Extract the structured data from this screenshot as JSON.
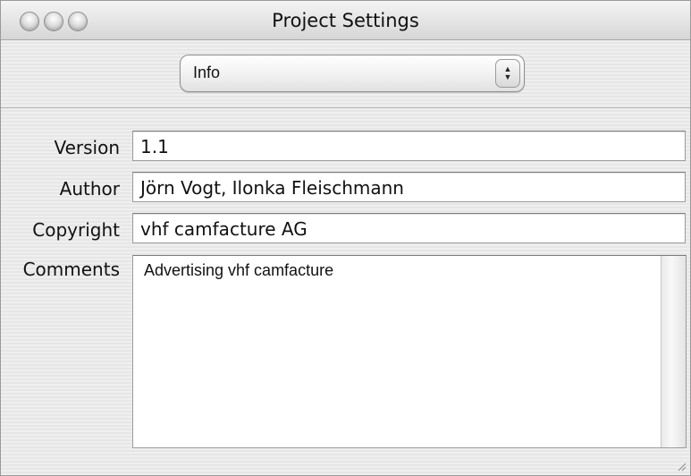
{
  "window": {
    "title": "Project Settings"
  },
  "popup": {
    "selected": "Info",
    "arrows_up": "▲",
    "arrows_down": "▼"
  },
  "form": {
    "version_label": "Version",
    "version_value": "1.1",
    "author_label": "Author",
    "author_value": "Jörn Vogt, Ilonka Fleischmann",
    "copyright_label": "Copyright",
    "copyright_value": "vhf camfacture AG",
    "comments_label": "Comments",
    "comments_value": "Advertising vhf camfacture"
  }
}
